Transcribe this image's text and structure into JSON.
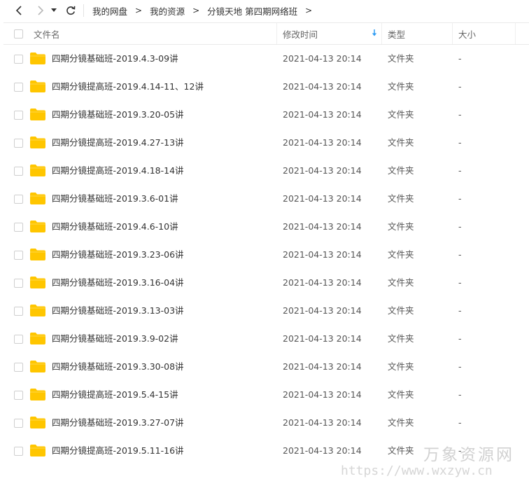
{
  "nav": {
    "back_icon": "chevron-left-icon",
    "forward_icon": "chevron-right-icon",
    "dropdown_icon": "caret-down-icon",
    "refresh_icon": "refresh-icon",
    "breadcrumb": [
      "我的网盘",
      "我的资源",
      "分镜天地 第四期网络班"
    ],
    "arrow": ">"
  },
  "header": {
    "name": "文件名",
    "modified": "修改时间",
    "type": "类型",
    "size": "大小",
    "sort_icon": "sort-down-arrow-icon",
    "sort_color": "#2b9af3"
  },
  "folder_color": "#ffc600",
  "rows": [
    {
      "name": "四期分镜基础班-2019.4.3-09讲",
      "date": "2021-04-13 20:14",
      "type": "文件夹",
      "size": "-"
    },
    {
      "name": "四期分镜提高班-2019.4.14-11、12讲",
      "date": "2021-04-13 20:14",
      "type": "文件夹",
      "size": "-"
    },
    {
      "name": "四期分镜基础班-2019.3.20-05讲",
      "date": "2021-04-13 20:14",
      "type": "文件夹",
      "size": "-"
    },
    {
      "name": "四期分镜提高班-2019.4.27-13讲",
      "date": "2021-04-13 20:14",
      "type": "文件夹",
      "size": "-"
    },
    {
      "name": "四期分镜提高班-2019.4.18-14讲",
      "date": "2021-04-13 20:14",
      "type": "文件夹",
      "size": "-"
    },
    {
      "name": "四期分镜基础班-2019.3.6-01讲",
      "date": "2021-04-13 20:14",
      "type": "文件夹",
      "size": "-"
    },
    {
      "name": "四期分镜基础班-2019.4.6-10讲",
      "date": "2021-04-13 20:14",
      "type": "文件夹",
      "size": "-"
    },
    {
      "name": "四期分镜基础班-2019.3.23-06讲",
      "date": "2021-04-13 20:14",
      "type": "文件夹",
      "size": "-"
    },
    {
      "name": "四期分镜基础班-2019.3.16-04讲",
      "date": "2021-04-13 20:14",
      "type": "文件夹",
      "size": "-"
    },
    {
      "name": "四期分镜基础班-2019.3.13-03讲",
      "date": "2021-04-13 20:14",
      "type": "文件夹",
      "size": "-"
    },
    {
      "name": "四期分镜基础班-2019.3.9-02讲",
      "date": "2021-04-13 20:14",
      "type": "文件夹",
      "size": "-"
    },
    {
      "name": "四期分镜基础班-2019.3.30-08讲",
      "date": "2021-04-13 20:14",
      "type": "文件夹",
      "size": "-"
    },
    {
      "name": "四期分镜提高班-2019.5.4-15讲",
      "date": "2021-04-13 20:14",
      "type": "文件夹",
      "size": "-"
    },
    {
      "name": "四期分镜基础班-2019.3.27-07讲",
      "date": "2021-04-13 20:14",
      "type": "文件夹",
      "size": "-"
    },
    {
      "name": "四期分镜提高班-2019.5.11-16讲",
      "date": "2021-04-13 20:14",
      "type": "文件夹",
      "size": "-"
    }
  ],
  "watermark": {
    "line1": "万象资源网",
    "line2": "https://www.wxzyw.cn"
  }
}
